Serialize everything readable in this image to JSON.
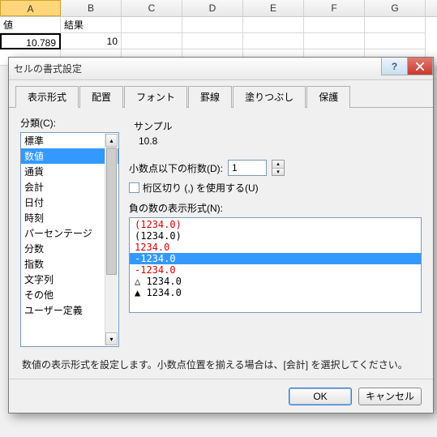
{
  "columns": [
    "A",
    "B",
    "C",
    "D",
    "E",
    "F",
    "G"
  ],
  "cells": {
    "a1": "値",
    "b1": "結果",
    "a2": "10.789",
    "b2": "10"
  },
  "dialog": {
    "title": "セルの書式設定",
    "tabs": [
      "表示形式",
      "配置",
      "フォント",
      "罫線",
      "塗りつぶし",
      "保護"
    ],
    "category_label": "分類(C):",
    "categories": [
      "標準",
      "数値",
      "通貨",
      "会計",
      "日付",
      "時刻",
      "パーセンテージ",
      "分数",
      "指数",
      "文字列",
      "その他",
      "ユーザー定義"
    ],
    "sample_label": "サンプル",
    "sample_value": "10.8",
    "decimals_label": "小数点以下の桁数(D):",
    "decimals_value": "1",
    "thousands_label": "桁区切り (,) を使用する(U)",
    "negative_label": "負の数の表示形式(N):",
    "negatives": [
      {
        "text": "(1234.0)",
        "red": true
      },
      {
        "text": "(1234.0)",
        "red": false
      },
      {
        "text": "1234.0",
        "red": true
      },
      {
        "text": "-1234.0",
        "red": false,
        "selected": true
      },
      {
        "text": "-1234.0",
        "red": true
      },
      {
        "text": "△ 1234.0",
        "red": false
      },
      {
        "text": "▲ 1234.0",
        "red": false
      }
    ],
    "help_text": "数値の表示形式を設定します。小数点位置を揃える場合は、[会計] を選択してください。",
    "ok": "OK",
    "cancel": "キャンセル"
  }
}
